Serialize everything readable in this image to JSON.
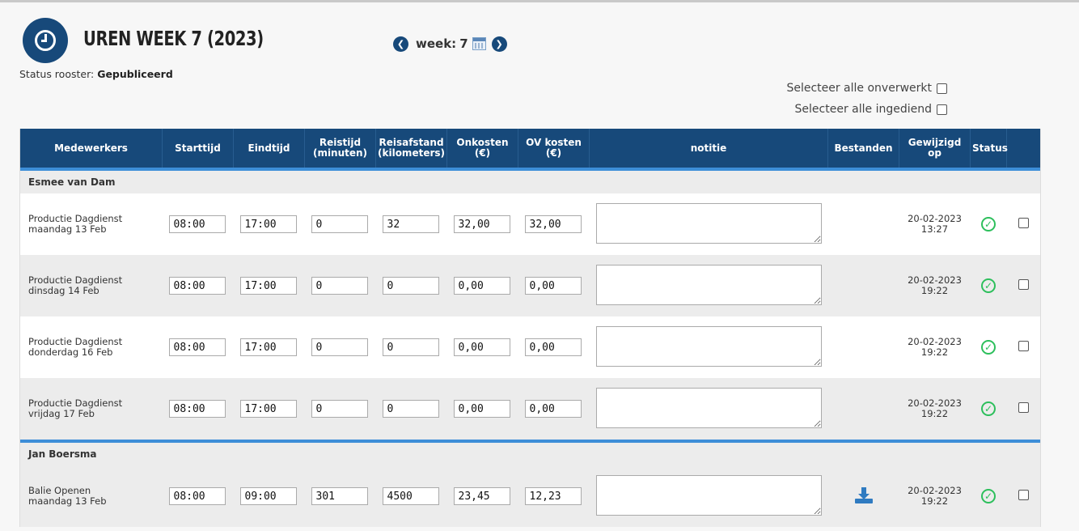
{
  "header": {
    "title": "UREN WEEK 7 (2023)",
    "week_label": "week:",
    "week_value": "7",
    "status_label": "Status rooster:",
    "status_value": "Gepubliceerd",
    "select_unworked": "Selecteer alle onverwerkt",
    "select_submitted": "Selecteer alle ingediend"
  },
  "columns": [
    "Medewerkers",
    "Starttijd",
    "Eindtijd",
    "Reistijd (minuten)",
    "Reisafstand (kilometers)",
    "Onkosten (€)",
    "OV kosten (€)",
    "notitie",
    "Bestanden",
    "Gewijzigd op",
    "Status"
  ],
  "employees": [
    {
      "name": "Esmee van Dam",
      "rows": [
        {
          "shift": "Productie Dagdienst",
          "day": "maandag 13 Feb",
          "start": "08:00",
          "end": "17:00",
          "travel_min": "0",
          "travel_km": "32",
          "expenses": "32,00",
          "ov": "32,00",
          "note": "",
          "file": false,
          "date": "20-02-2023",
          "time": "13:27"
        },
        {
          "shift": "Productie Dagdienst",
          "day": "dinsdag 14 Feb",
          "start": "08:00",
          "end": "17:00",
          "travel_min": "0",
          "travel_km": "0",
          "expenses": "0,00",
          "ov": "0,00",
          "note": "",
          "file": false,
          "date": "20-02-2023",
          "time": "19:22"
        },
        {
          "shift": "Productie Dagdienst",
          "day": "donderdag 16 Feb",
          "start": "08:00",
          "end": "17:00",
          "travel_min": "0",
          "travel_km": "0",
          "expenses": "0,00",
          "ov": "0,00",
          "note": "",
          "file": false,
          "date": "20-02-2023",
          "time": "19:22"
        },
        {
          "shift": "Productie Dagdienst",
          "day": "vrijdag 17 Feb",
          "start": "08:00",
          "end": "17:00",
          "travel_min": "0",
          "travel_km": "0",
          "expenses": "0,00",
          "ov": "0,00",
          "note": "",
          "file": false,
          "date": "20-02-2023",
          "time": "19:22"
        }
      ]
    },
    {
      "name": "Jan Boersma",
      "rows": [
        {
          "shift": "Balie Openen",
          "day": "maandag 13 Feb",
          "start": "08:00",
          "end": "09:00",
          "travel_min": "301",
          "travel_km": "4500",
          "expenses": "23,45",
          "ov": "12,23",
          "note": "",
          "file": true,
          "date": "20-02-2023",
          "time": "19:22"
        }
      ]
    }
  ],
  "colors": {
    "header_bg": "#17497a",
    "separator": "#3d8ed8",
    "status_ok": "#2dbf5c",
    "download": "#2f7bc1"
  },
  "icons": {
    "logo": "clock-icon",
    "prev": "chevron-left-icon",
    "next": "chevron-right-icon",
    "calendar": "calendar-icon",
    "status": "check-circle-icon",
    "file": "download-icon"
  }
}
